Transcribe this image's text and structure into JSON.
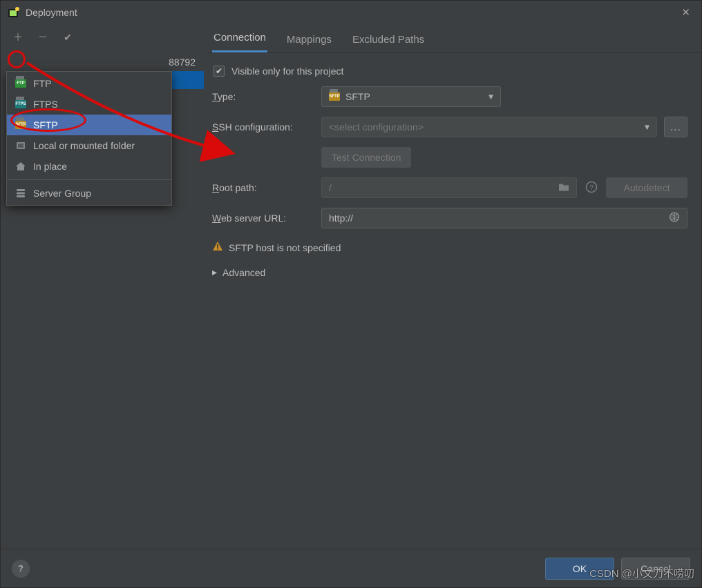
{
  "dialog": {
    "title": "Deployment",
    "close_glyph": "✕"
  },
  "toolbar": {
    "add_glyph": "＋",
    "remove_glyph": "－",
    "check_glyph": "✔"
  },
  "left": {
    "visible_server_tail": "88792"
  },
  "popup": {
    "items": [
      {
        "label": "FTP",
        "badge_color": "#2f8f3a",
        "badge_text": "FTP"
      },
      {
        "label": "FTPS",
        "badge_color": "#1f7a7a",
        "badge_text": "FTPS"
      },
      {
        "label": "SFTP",
        "badge_color": "#b58a1e",
        "badge_text": "SFTP",
        "selected": true
      },
      {
        "label": "Local or mounted folder",
        "icon": "folder"
      },
      {
        "label": "In place",
        "icon": "home"
      }
    ],
    "group_label": "Server Group"
  },
  "tabs": [
    {
      "label": "Connection",
      "active": true
    },
    {
      "label": "Mappings"
    },
    {
      "label": "Excluded Paths"
    }
  ],
  "form": {
    "visible_only": {
      "label": "Visible only for this project",
      "checked": true
    },
    "type": {
      "label": "Type:",
      "value": "SFTP",
      "badge_color": "#b58a1e",
      "badge_text": "SFTP"
    },
    "ssh": {
      "label": "SSH configuration:",
      "placeholder": "<select configuration>",
      "ellipsis": "..."
    },
    "test": {
      "label": "Test Connection"
    },
    "root": {
      "label": "Root path:",
      "value": "/"
    },
    "autodetect": {
      "label": "Autodetect"
    },
    "web": {
      "label": "Web server URL:",
      "value": "http://"
    },
    "warning": "SFTP host is not specified",
    "advanced": "Advanced"
  },
  "footer": {
    "help_glyph": "?",
    "ok": "OK",
    "cancel": "Cancel"
  },
  "watermark": "CSDN @小文刀不唠叨"
}
